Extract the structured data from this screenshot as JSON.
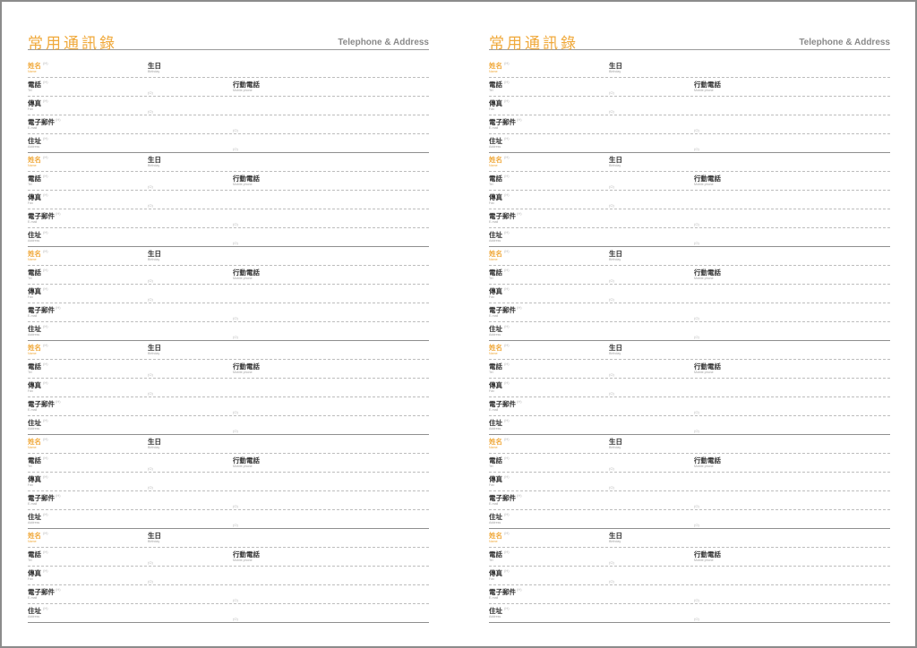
{
  "pages": [
    {
      "title": "常用通訊錄",
      "subtitle": "Telephone & Address"
    },
    {
      "title": "常用通訊錄",
      "subtitle": "Telephone & Address"
    }
  ],
  "entry_count": 6,
  "labels": {
    "name": "姓名",
    "name_en": "Name",
    "birthday": "生日",
    "birthday_en": "Birthday",
    "tel": "電話",
    "tel_en": "Tel",
    "mobile": "行動電話",
    "mobile_en": "Mobile phone",
    "fax": "傳真",
    "fax_en": "Fax",
    "email": "電子郵件",
    "email_en": "E-mail",
    "address": "住址",
    "address_en": "Address",
    "paren": "(H)",
    "paren_o": "(O)"
  }
}
